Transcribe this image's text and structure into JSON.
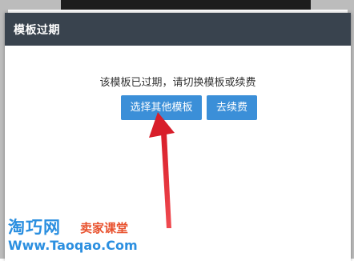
{
  "dialog": {
    "title": "模板过期",
    "message": "该模板已过期，请切换模板或续费",
    "choose_other_label": "选择其他模板",
    "renew_label": "去续费"
  },
  "watermark": {
    "logo": "淘巧网",
    "slogan": "卖家课堂",
    "url": "Www.Taoqao.Com"
  },
  "colors": {
    "header_bg": "#39434e",
    "button_bg": "#3b8fd8",
    "arrow": "#e8343b",
    "watermark_blue": "#2b8fe0",
    "watermark_red": "#e8502c"
  }
}
